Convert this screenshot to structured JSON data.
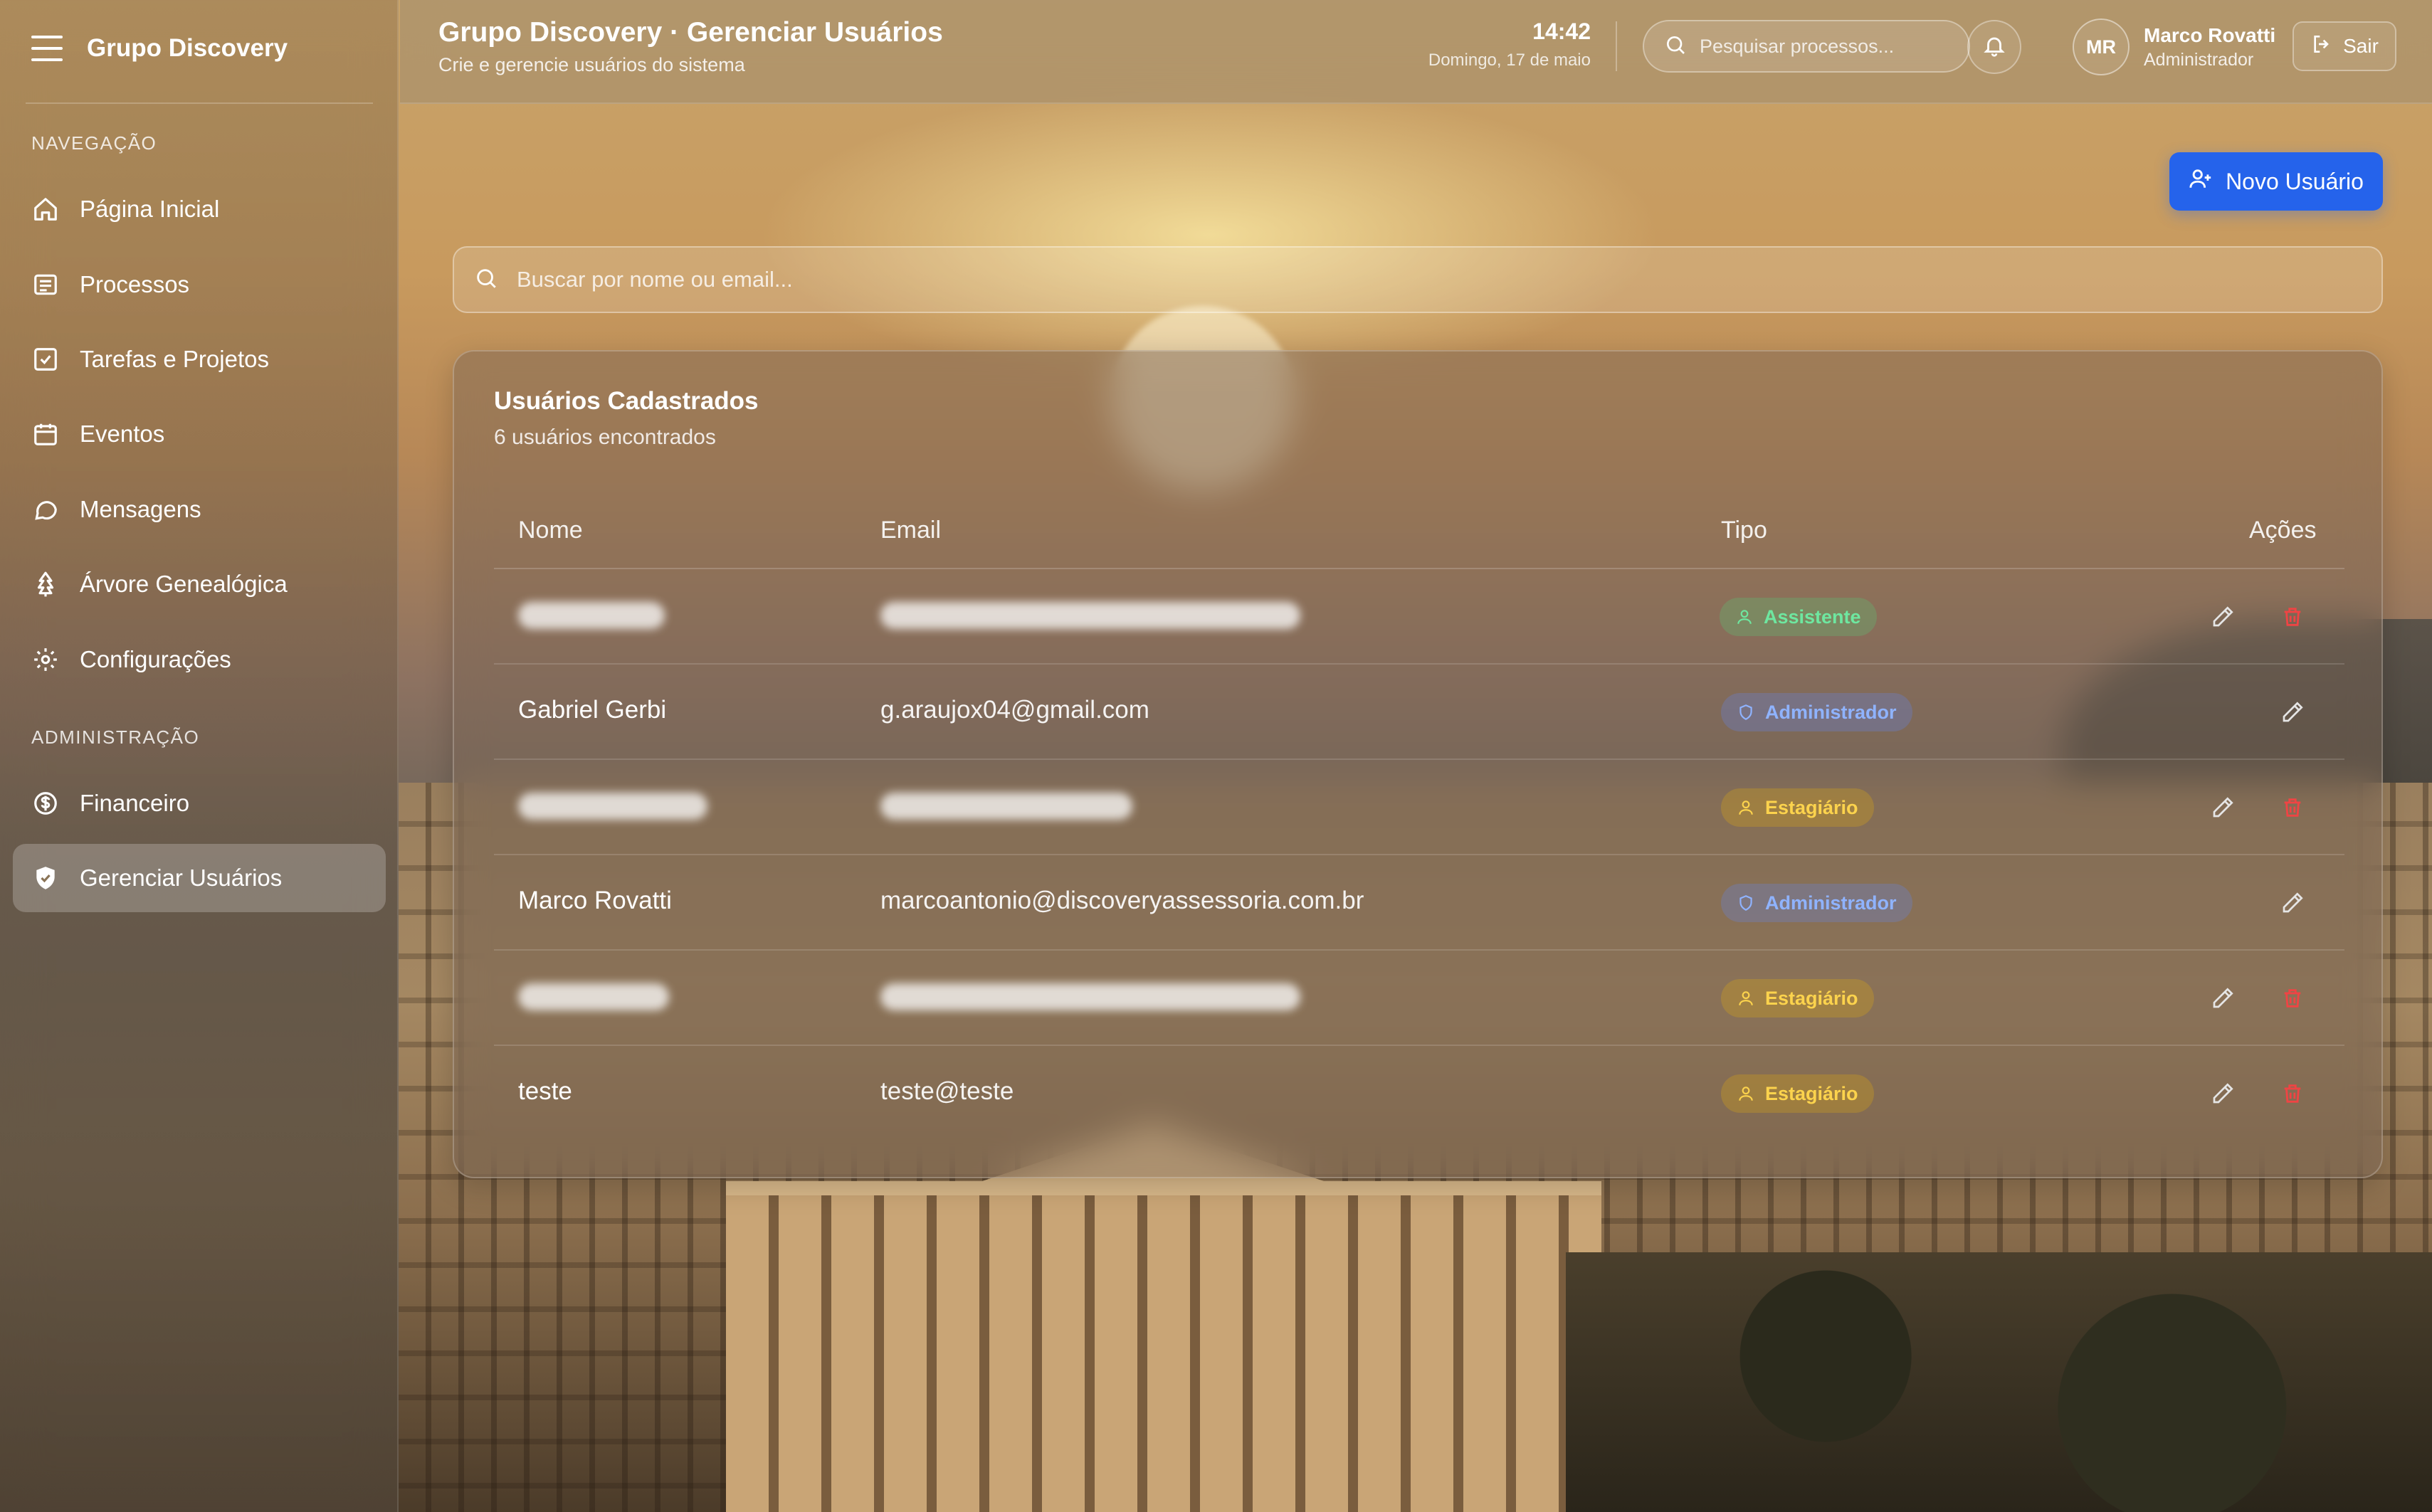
{
  "app": {
    "brand": "Grupo Discovery",
    "menu_icon": "hamburger-icon"
  },
  "sidebar": {
    "section_nav": "NAVEGAÇÃO",
    "section_admin": "ADMINISTRAÇÃO",
    "nav_items": [
      {
        "label": "Página Inicial",
        "icon": "home-icon"
      },
      {
        "label": "Processos",
        "icon": "document-list-icon"
      },
      {
        "label": "Tarefas e Projetos",
        "icon": "checkbox-icon"
      },
      {
        "label": "Eventos",
        "icon": "calendar-icon"
      },
      {
        "label": "Mensagens",
        "icon": "chat-bubble-icon"
      },
      {
        "label": "Árvore Genealógica",
        "icon": "tree-icon"
      },
      {
        "label": "Configurações",
        "icon": "gear-icon"
      }
    ],
    "admin_items": [
      {
        "label": "Financeiro",
        "icon": "dollar-circle-icon"
      },
      {
        "label": "Gerenciar Usuários",
        "icon": "shield-icon",
        "active": true
      }
    ]
  },
  "header": {
    "title": "Grupo Discovery · Gerenciar Usuários",
    "subtitle": "Crie e gerencie usuários do sistema",
    "time": "14:42",
    "date": "Domingo, 17 de maio",
    "search_placeholder": "Pesquisar processos...",
    "user_initials": "MR",
    "user_name": "Marco Rovatti",
    "user_role": "Administrador",
    "logout_label": "Sair"
  },
  "main": {
    "new_user_label": "Novo Usuário",
    "search_placeholder": "Buscar por nome ou email..."
  },
  "users_card": {
    "title": "Usuários Cadastrados",
    "subtitle": "6 usuários encontrados",
    "columns": [
      "Nome",
      "Email",
      "Tipo",
      "Ações"
    ],
    "rows": [
      {
        "name": "",
        "email": "",
        "type": "Assistente",
        "type_color": "green",
        "redacted": true,
        "can_delete": true
      },
      {
        "name": "Gabriel Gerbi",
        "email": "g.araujox04@gmail.com",
        "type": "Administrador",
        "type_color": "blue",
        "redacted": false,
        "can_delete": false
      },
      {
        "name": "",
        "email": "",
        "type": "Estagiário",
        "type_color": "yellow",
        "redacted": true,
        "can_delete": true
      },
      {
        "name": "Marco Rovatti",
        "email": "marcoantonio@discoveryassessoria.com.br",
        "type": "Administrador",
        "type_color": "blue",
        "redacted": false,
        "can_delete": false
      },
      {
        "name": "",
        "email": "",
        "type": "Estagiário",
        "type_color": "yellow",
        "redacted": true,
        "can_delete": true
      },
      {
        "name": "teste",
        "email": "teste@teste",
        "type": "Estagiário",
        "type_color": "yellow",
        "redacted": false,
        "can_delete": true
      }
    ]
  },
  "colors": {
    "accent": "#2563eb",
    "delete": "#ef4444",
    "badge_green": "#6ee7a0",
    "badge_blue": "#8fb3ff",
    "badge_yellow": "#fcd34d"
  }
}
